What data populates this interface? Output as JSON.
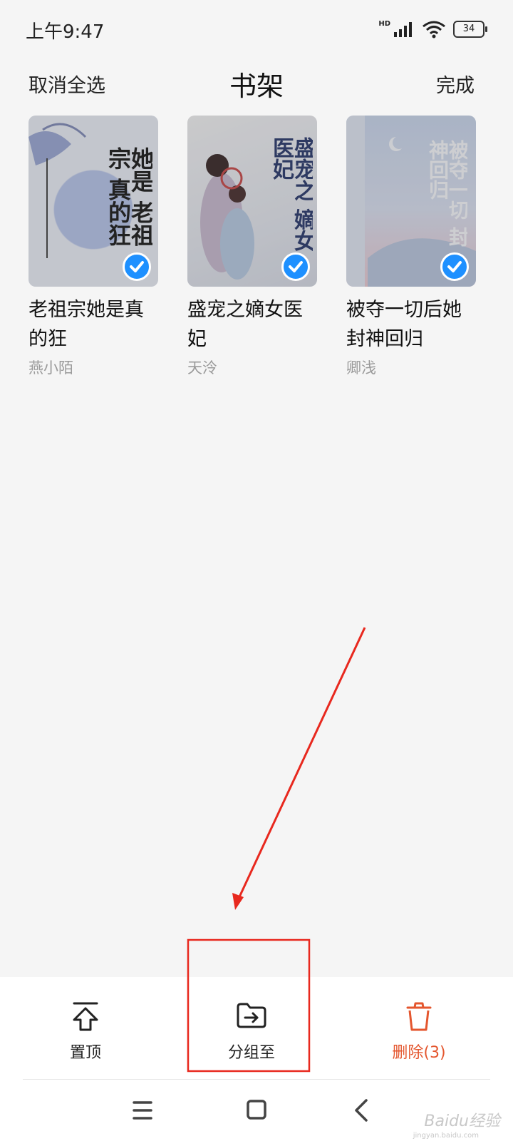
{
  "status_bar": {
    "time": "上午9:47",
    "network_label": "HD",
    "battery": "34"
  },
  "header": {
    "left_action": "取消全选",
    "title": "书架",
    "right_action": "完成"
  },
  "books": [
    {
      "title": "老祖宗她是真的狂",
      "author": "燕小陌",
      "selected": true,
      "cover_art": "她是 老祖宗 真的狂"
    },
    {
      "title": "盛宠之嫡女医妃",
      "author": "天泠",
      "selected": true,
      "cover_art": "盛宠之 嫡女医妃"
    },
    {
      "title": "被夺一切后她封神回归",
      "author": "卿浅",
      "selected": true,
      "cover_art": "被夺一切 封神回归"
    }
  ],
  "actions": {
    "pin": {
      "label": "置顶",
      "icon": "pin-top-icon"
    },
    "group": {
      "label": "分组至",
      "icon": "folder-move-icon"
    },
    "delete": {
      "label": "删除(3)",
      "icon": "trash-icon"
    }
  },
  "watermark": {
    "text": "Baidu经验",
    "sub": "jingyan.baidu.com"
  },
  "colors": {
    "background": "#f5f5f5",
    "check": "#1e90ff",
    "delete": "#e4562e",
    "annotation": "#e8281e"
  }
}
